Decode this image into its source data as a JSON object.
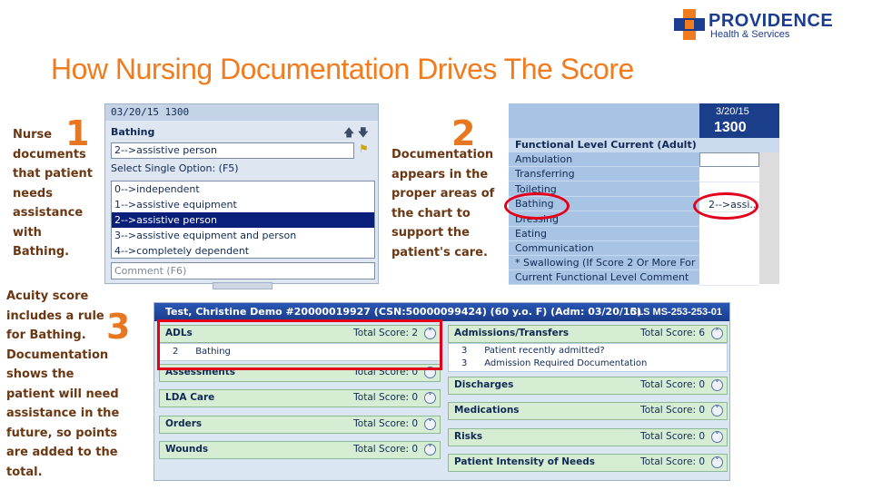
{
  "logo": {
    "name": "PROVIDENCE",
    "subtitle": "Health & Services"
  },
  "title": "How Nursing Documentation Drives The Score",
  "callouts": {
    "step1": {
      "number": "1",
      "lines": [
        "Nurse",
        "documents",
        "that patient",
        "needs",
        "assistance",
        "with",
        "Bathing."
      ]
    },
    "step2": {
      "number": "2",
      "lines": [
        "Documentation",
        "appears in the",
        "proper areas of",
        "the chart to",
        "support the",
        "patient's care."
      ]
    },
    "step3": {
      "number": "3",
      "lines": [
        "Acuity score",
        "includes a rule",
        "for Bathing.",
        "Documentation",
        "shows the",
        "patient will need",
        "assistance in the",
        "future, so points",
        "are added to the",
        "total."
      ]
    }
  },
  "panel1": {
    "datetime": "03/20/15 1300",
    "field_label": "Bathing",
    "input_value": "2-->assistive person",
    "select_label": "Select Single Option: (F5)",
    "options": [
      "0-->independent",
      "1-->assistive equipment",
      "2-->assistive person",
      "3-->assistive equipment and person",
      "4-->completely dependent"
    ],
    "selected_index": 2,
    "comment_placeholder": "Comment (F6)"
  },
  "panel2": {
    "date": "3/20/15",
    "time": "1300",
    "section_title": "Functional Level Current (Adult)",
    "rows": [
      "Ambulation",
      "Transferring",
      "Toileting",
      "Bathing",
      "Dressing",
      "Eating",
      "Communication",
      "* Swallowing (If Score 2 Or More For",
      "Current Functional Level Comment"
    ],
    "bathing_value": "2-->assi..."
  },
  "panel3": {
    "header": "Test, Christine Demo #20000019927 (CSN:50000099424)  (60 y.o. F)  (Adm: 03/20/15)",
    "header_right": "CLS MS-253-253-01",
    "left_sections": [
      {
        "name": "ADLs",
        "score": "Total Score: 2",
        "toggle": "˄",
        "items": [
          {
            "num": "2",
            "text": "Bathing"
          }
        ]
      },
      {
        "name": "Assessments",
        "score": "Total Score: 0",
        "toggle": "˅"
      },
      {
        "name": "LDA Care",
        "score": "Total Score: 0",
        "toggle": "˅"
      },
      {
        "name": "Orders",
        "score": "Total Score: 0",
        "toggle": "˅"
      },
      {
        "name": "Wounds",
        "score": "Total Score: 0",
        "toggle": "˅"
      }
    ],
    "right_sections": [
      {
        "name": "Admissions/Transfers",
        "score": "Total Score: 6",
        "toggle": "˄",
        "items": [
          {
            "num": "3",
            "text": "Patient recently admitted?"
          },
          {
            "num": "3",
            "text": "Admission Required Documentation"
          }
        ]
      },
      {
        "name": "Discharges",
        "score": "Total Score: 0",
        "toggle": "˅"
      },
      {
        "name": "Medications",
        "score": "Total Score: 0",
        "toggle": "˅"
      },
      {
        "name": "Risks",
        "score": "Total Score: 0",
        "toggle": "˅"
      },
      {
        "name": "Patient Intensity of Needs",
        "score": "Total Score: 0",
        "toggle": "˅"
      }
    ]
  },
  "colors": {
    "title": "#f07c1f",
    "callout_text": "#6b3712",
    "number": "#e87722",
    "highlight": "#e3001b",
    "brand": "#1b3d8f"
  },
  "icons": {
    "logo": "cross-logo-icon",
    "move_up": "arrow-up-icon",
    "move_down": "arrow-down-icon",
    "flag": "flag-icon",
    "collapse": "collapse-icon",
    "expand": "expand-icon"
  }
}
